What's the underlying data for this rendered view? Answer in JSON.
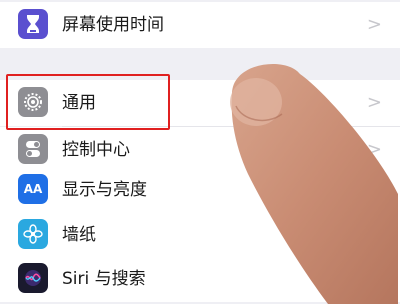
{
  "settings": {
    "items": [
      {
        "label": "屏幕使用时间",
        "icon": "hourglass-icon",
        "color": "#5a4fcf"
      },
      {
        "label": "通用",
        "icon": "gear-icon",
        "color": "#8e8e93"
      },
      {
        "label": "控制中心",
        "icon": "toggle-switches-icon",
        "color": "#8e8e93"
      },
      {
        "label": "显示与亮度",
        "icon": "aa-text-icon",
        "color": "#1f6fe6",
        "glyph": "AA"
      },
      {
        "label": "墙纸",
        "icon": "flower-icon",
        "color": "#2aa8e0"
      },
      {
        "label": "Siri 与搜索",
        "icon": "siri-icon",
        "color": "#1a1a2e"
      }
    ],
    "chevron": ">",
    "highlight_color": "#e02020"
  }
}
